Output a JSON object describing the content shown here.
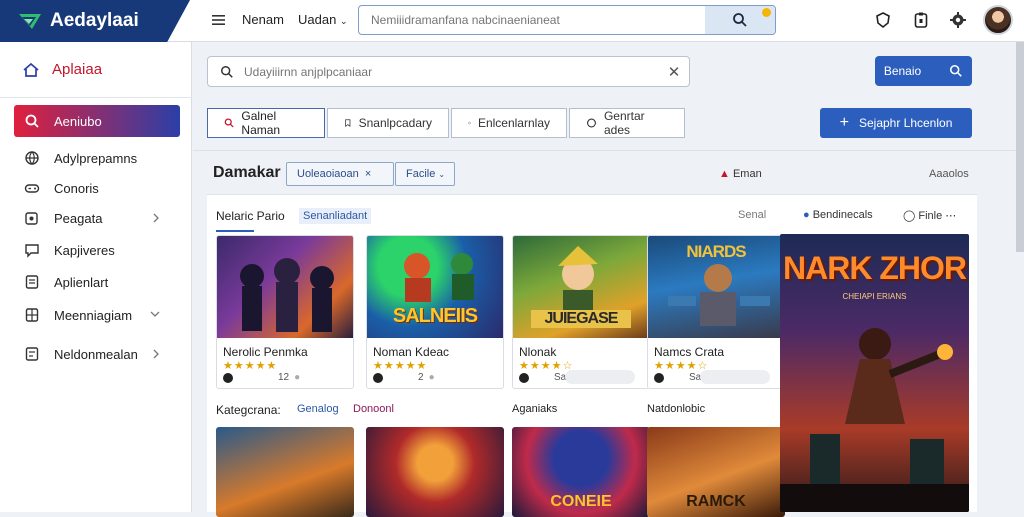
{
  "app": {
    "name": "Aedaylaai"
  },
  "topnav": {
    "item1": "Nenam",
    "item2": "Uadan"
  },
  "topsearch": {
    "placeholder": "Nemiiidramanfana nabcinaenianeat"
  },
  "sidebar": {
    "header": "Aplaiaa",
    "items": [
      {
        "label": "Aeniubo",
        "icon": "ring-icon"
      },
      {
        "label": "Adylprepamns",
        "icon": "globe-icon"
      },
      {
        "label": "Conoris",
        "icon": "gamepad-icon"
      },
      {
        "label": "Peagata",
        "icon": "puzzle-icon"
      },
      {
        "label": "Kapjiveres",
        "icon": "chat-icon"
      },
      {
        "label": "Aplienlart",
        "icon": "document-icon"
      },
      {
        "label": "Meenniagiam",
        "icon": "grid-icon"
      },
      {
        "label": "Neldonmealan",
        "icon": "list-icon"
      }
    ]
  },
  "main": {
    "search_placeholder": "Udayiiirnn anjplpcaniaar",
    "go_label": "Benaio",
    "tabs": [
      "Galnel Naman",
      "Snanlpcadary",
      "Enlcenlarnlay",
      "Genrtar ades"
    ],
    "create_label": "Sejaphr Lhcenlon",
    "section_title": "Damakar",
    "select1": "Uoleaoiaoan",
    "select2": "Facile",
    "right_a": "Eman",
    "right_b": "Aaaolos"
  },
  "panel": {
    "title": "Nelaric Pario",
    "tag": "Senanliadant",
    "hdr_a": "Senal",
    "hdr_b": "Bendinecals",
    "hdr_c": "Finle",
    "cards": [
      {
        "name": "Nerolic Penmka",
        "art": "",
        "count": "12",
        "rating": 4.5
      },
      {
        "name": "Noman Kdeac",
        "art": "SALNEIIS",
        "count": "2",
        "rating": 4.5
      },
      {
        "name": "Nlonak",
        "art": "JUIEGASE",
        "count": "Sa Db",
        "rating": 3.5
      },
      {
        "name": "Namcs Crata",
        "art": "NIARDS",
        "count": "Sa Db",
        "rating": 3.5
      }
    ],
    "row2": {
      "label1": "Kategcrana:",
      "label2": "Genalog",
      "label3": "Donoonl",
      "label4": "Aganiaks",
      "label5": "Natdonlobic"
    },
    "row2_art": [
      "",
      "",
      "CONEIE",
      "RAMCK"
    ],
    "banner": {
      "title": "NARK ZHOR",
      "subtitle": "CHEIAPI ERIANS"
    }
  },
  "colors": {
    "brand": "#17397a",
    "accent": "#2c5fbd",
    "active_red": "#e0203d"
  }
}
